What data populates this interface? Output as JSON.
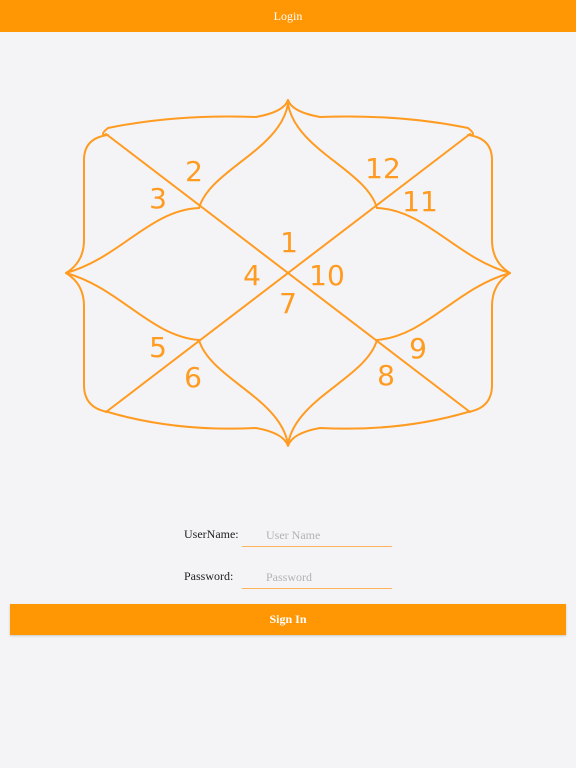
{
  "header": {
    "title": "Login"
  },
  "logo": {
    "icon": "horoscope-chart-logo",
    "color": "#ff9b21",
    "house_numbers": [
      "1",
      "2",
      "3",
      "4",
      "5",
      "6",
      "7",
      "8",
      "9",
      "10",
      "11",
      "12"
    ]
  },
  "form": {
    "username_label": "UserName:",
    "username_placeholder": "User Name",
    "username_value": "",
    "password_label": "Password:",
    "password_placeholder": "Password",
    "password_value": ""
  },
  "signin_label": "Sign In",
  "colors": {
    "accent": "#ff9604",
    "background": "#f4f4f6"
  }
}
